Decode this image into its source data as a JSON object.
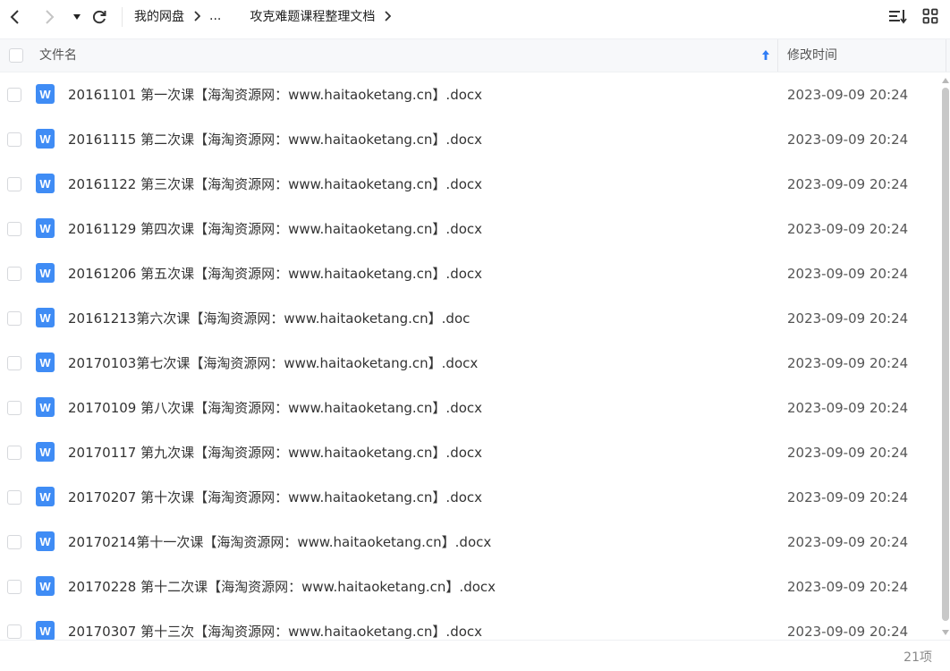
{
  "toolbar": {
    "back_icon": "chevron-left-icon",
    "forward_icon": "chevron-right-icon",
    "dropdown_icon": "caret-down-icon",
    "refresh_icon": "refresh-icon",
    "sort_icon": "sort-list-icon",
    "grid_icon": "grid-view-icon"
  },
  "breadcrumb": {
    "root": "我的网盘",
    "ellipsis": "...",
    "current": "攻克难题课程整理文档"
  },
  "header": {
    "name_label": "文件名",
    "time_label": "修改时间",
    "sort_direction": "ascending"
  },
  "colors": {
    "file_icon": "#3f8cf5",
    "sort_arrow": "#2f7df6",
    "header_bg": "#f7f8fa"
  },
  "files": [
    {
      "name": "20161101 第一次课【海淘资源网：www.haitaoketang.cn】.docx",
      "time": "2023-09-09 20:24",
      "icon": "W"
    },
    {
      "name": "20161115 第二次课【海淘资源网：www.haitaoketang.cn】.docx",
      "time": "2023-09-09 20:24",
      "icon": "W"
    },
    {
      "name": "20161122 第三次课【海淘资源网：www.haitaoketang.cn】.docx",
      "time": "2023-09-09 20:24",
      "icon": "W"
    },
    {
      "name": "20161129 第四次课【海淘资源网：www.haitaoketang.cn】.docx",
      "time": "2023-09-09 20:24",
      "icon": "W"
    },
    {
      "name": "20161206 第五次课【海淘资源网：www.haitaoketang.cn】.docx",
      "time": "2023-09-09 20:24",
      "icon": "W"
    },
    {
      "name": "20161213第六次课【海淘资源网：www.haitaoketang.cn】.doc",
      "time": "2023-09-09 20:24",
      "icon": "W"
    },
    {
      "name": "20170103第七次课【海淘资源网：www.haitaoketang.cn】.docx",
      "time": "2023-09-09 20:24",
      "icon": "W"
    },
    {
      "name": "20170109 第八次课【海淘资源网：www.haitaoketang.cn】.docx",
      "time": "2023-09-09 20:24",
      "icon": "W"
    },
    {
      "name": "20170117 第九次课【海淘资源网：www.haitaoketang.cn】.docx",
      "time": "2023-09-09 20:24",
      "icon": "W"
    },
    {
      "name": "20170207 第十次课【海淘资源网：www.haitaoketang.cn】.docx",
      "time": "2023-09-09 20:24",
      "icon": "W"
    },
    {
      "name": "20170214第十一次课【海淘资源网：www.haitaoketang.cn】.docx",
      "time": "2023-09-09 20:24",
      "icon": "W"
    },
    {
      "name": "20170228 第十二次课【海淘资源网：www.haitaoketang.cn】.docx",
      "time": "2023-09-09 20:24",
      "icon": "W"
    },
    {
      "name": "20170307 第十三次【海淘资源网：www.haitaoketang.cn】.docx",
      "time": "2023-09-09 20:24",
      "icon": "W"
    }
  ],
  "footer": {
    "count": "21项"
  }
}
